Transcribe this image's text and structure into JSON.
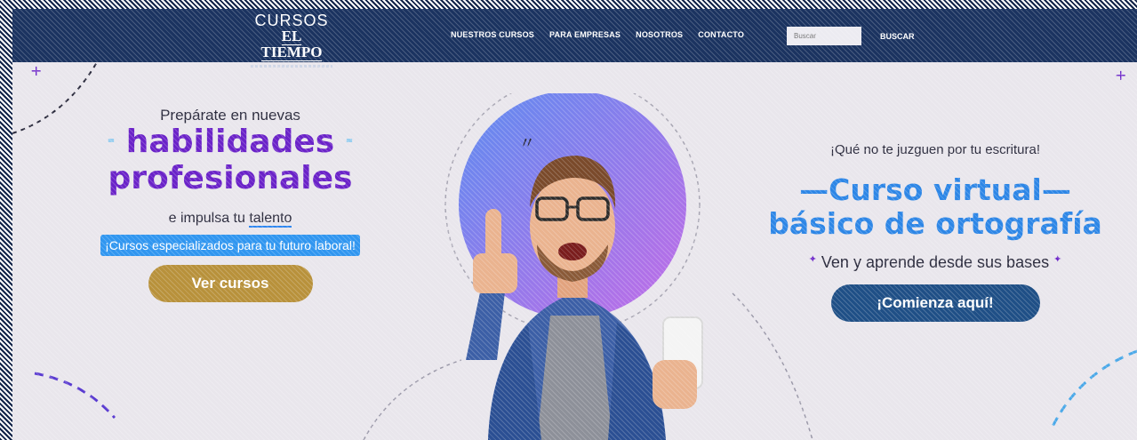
{
  "colors": {
    "nav_bg": "#1b3360",
    "page_bg": "#e9e6ec",
    "purple": "#6a22c8",
    "blue": "#2d86e6",
    "gold": "#b8913b",
    "navy_button": "#1f4f86"
  },
  "header": {
    "logo": {
      "line1": "CURSOS",
      "line2": "EL TIEMPO"
    },
    "nav": [
      {
        "label": "NUESTROS CURSOS"
      },
      {
        "label": "PARA EMPRESAS"
      },
      {
        "label": "NOSOTROS"
      },
      {
        "label": "CONTACTO"
      }
    ],
    "search": {
      "placeholder": "Buscar",
      "value": ""
    },
    "search_button": "BUSCAR"
  },
  "left_promo": {
    "pre_title": "Prepárate en nuevas",
    "headline_1": "habilidades",
    "headline_2": "profesionales",
    "sub_prefix": "e impulsa tu ",
    "sub_highlight": "talento",
    "pill": "¡Cursos especializados para tu futuro laboral!",
    "button": "Ver cursos"
  },
  "right_promo": {
    "pre_title": "¡Qué no te juzguen por tu escritura!",
    "title_1": "Curso virtual",
    "title_2": "básico de ortografía",
    "subtitle": "Ven y aprende desde sus bases",
    "button": "¡Comienza aquí!"
  },
  "icons": [
    "sparkle-icon",
    "thumbs-up-person-illustration",
    "phone-icon"
  ]
}
